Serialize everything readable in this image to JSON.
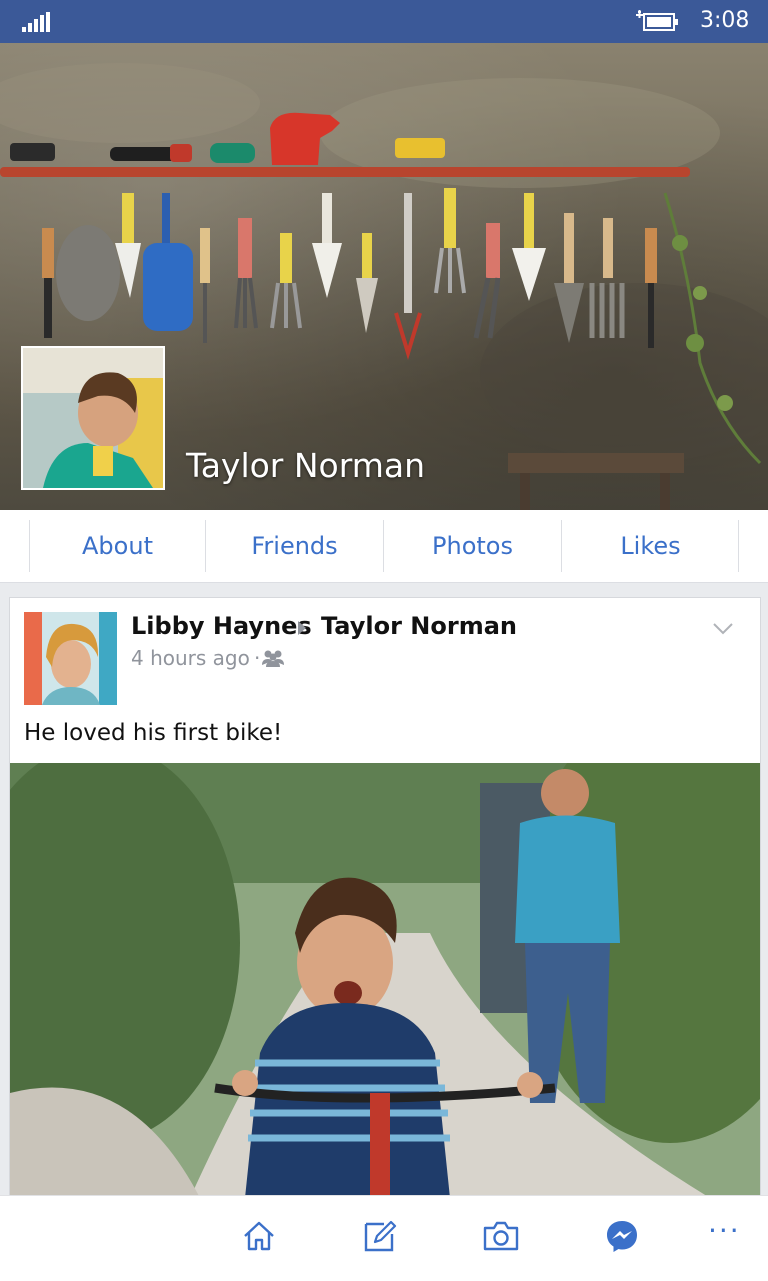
{
  "status_bar": {
    "time": "3:08",
    "signal_icon": "signal-icon",
    "battery_icon": "battery-charging-icon"
  },
  "profile": {
    "name": "Taylor Norman"
  },
  "tabs": [
    {
      "label": "About"
    },
    {
      "label": "Friends"
    },
    {
      "label": "Photos"
    },
    {
      "label": "Likes"
    }
  ],
  "post": {
    "author": "Libby Haynes",
    "target": "Taylor Norman",
    "time": "4 hours ago",
    "separator": "·",
    "audience_icon": "friends-icon",
    "caption": "He loved his first bike!"
  },
  "app_bar": {
    "items": [
      "home-icon",
      "compose-icon",
      "camera-icon",
      "messenger-icon",
      "more-icon"
    ],
    "more_label": "···"
  },
  "colors": {
    "brand": "#3b5998",
    "accent": "#3b70c9"
  }
}
